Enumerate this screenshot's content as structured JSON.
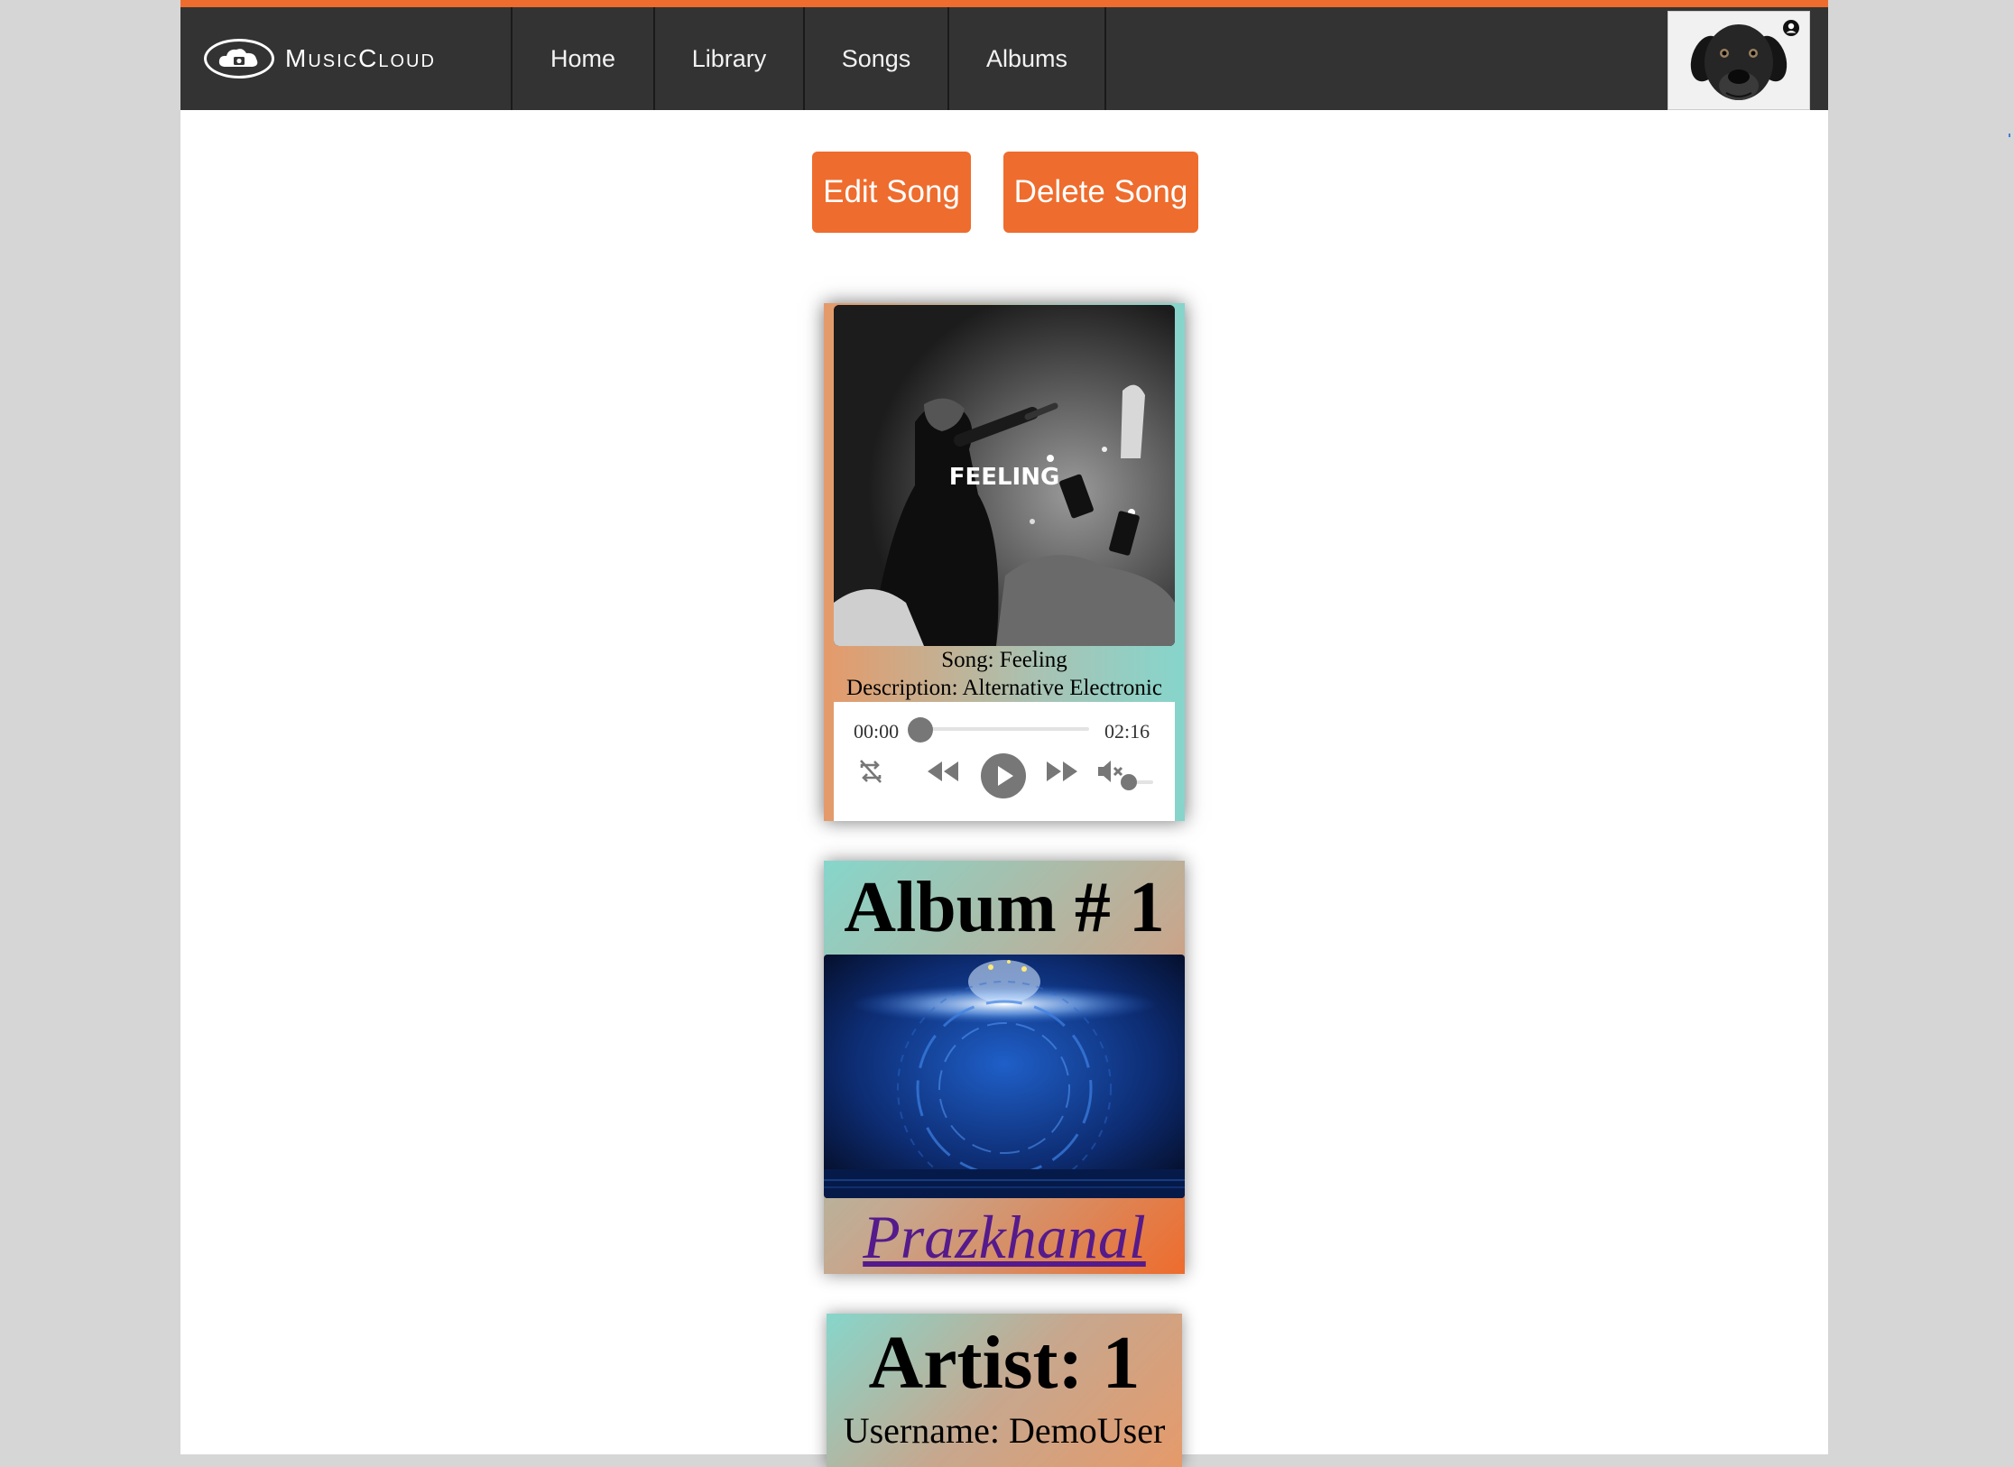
{
  "colors": {
    "accent": "#ee6c2d",
    "navbar": "#333333",
    "link": "#551a8b"
  },
  "brand": {
    "name": "MusicCloud",
    "logo_icon": "cloud-camera-icon"
  },
  "nav": {
    "items": [
      "Home",
      "Library",
      "Songs",
      "Albums"
    ]
  },
  "user": {
    "avatar_icon": "dog-avatar",
    "badge_icon": "user-circle-icon"
  },
  "actions": {
    "edit_label": "Edit Song",
    "delete_label": "Delete Song"
  },
  "song": {
    "cover_text": "FEELING",
    "title_line": "Song: Feeling",
    "description_line": "Description: Alternative Electronic"
  },
  "player": {
    "current_time": "00:00",
    "duration": "02:16",
    "progress": 0,
    "icons": [
      "repeat-off-icon",
      "rewind-icon",
      "play-icon",
      "fast-forward-icon",
      "mute-icon"
    ],
    "volume": 0
  },
  "album": {
    "title": "Album # 1",
    "artist_link": "Prazkhanal"
  },
  "artist": {
    "title": "Artist: 1",
    "username_line": "Username: DemoUser"
  }
}
